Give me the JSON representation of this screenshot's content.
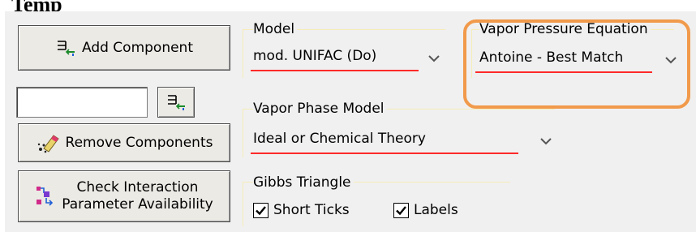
{
  "heading": "Temp",
  "buttons": {
    "add_component": "Add Component",
    "remove_components": "Remove Components",
    "check_line1": "Check Interaction",
    "check_line2": "Parameter Availability"
  },
  "component_input": {
    "value": "",
    "placeholder": ""
  },
  "model": {
    "label": "Model",
    "value": "mod. UNIFAC (Do)"
  },
  "vapor_pressure": {
    "label": "Vapor Pressure Equation",
    "value": "Antoine - Best Match"
  },
  "vapor_phase": {
    "label": "Vapor Phase Model",
    "value": "Ideal or Chemical Theory"
  },
  "gibbs": {
    "label": "Gibbs Triangle",
    "short_ticks": {
      "label": "Short Ticks",
      "checked": true
    },
    "labels": {
      "label": "Labels",
      "checked": true
    }
  },
  "colors": {
    "highlight": "#f19a4b",
    "underline": "#ff2a2a",
    "group_line": "#f5ecb8"
  }
}
